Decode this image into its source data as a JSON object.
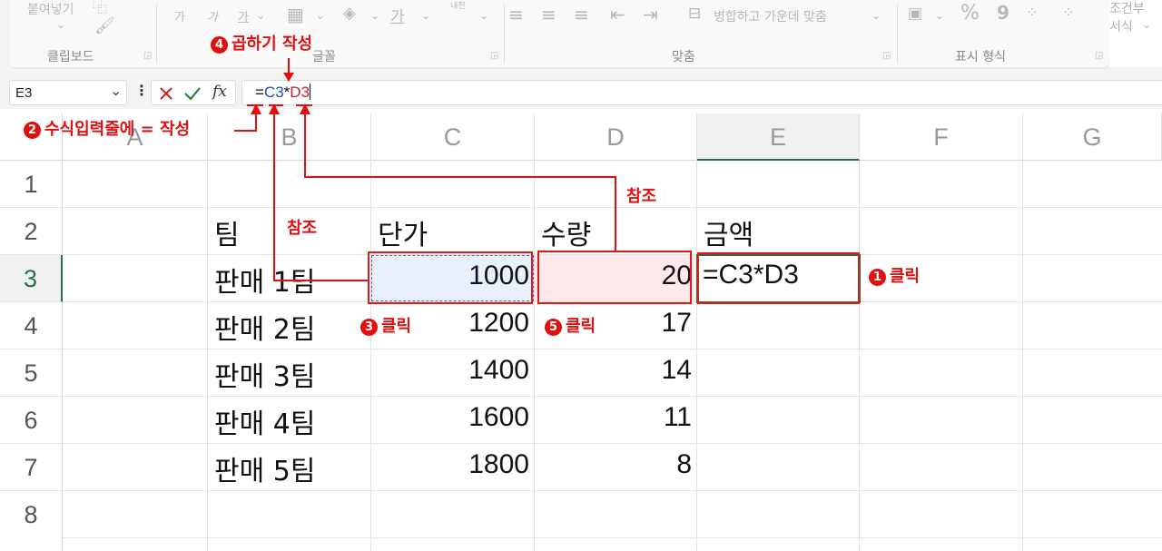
{
  "ribbon": {
    "clipboard": {
      "paste_label": "붙여넣기",
      "group_label": "클립보드"
    },
    "font": {
      "group_label": "글꼴",
      "btn1": "가",
      "btn2": "가",
      "btn3": "가",
      "btn4": "가",
      "phonetic": "내천"
    },
    "alignment": {
      "merge_label": "병합하고 가운데 맞춤",
      "group_label": "맞춤"
    },
    "number": {
      "percent": "%",
      "comma": "9",
      "group_label": "표시 형식"
    },
    "styles": {
      "conditional_label": "조건부 서식"
    }
  },
  "formula_bar": {
    "name_box": "E3",
    "formula_eq": "=",
    "formula_ref1": "C3",
    "formula_op": "*",
    "formula_ref2": "D3",
    "fx": "fx"
  },
  "sheet": {
    "columns": [
      "A",
      "B",
      "C",
      "D",
      "E",
      "F",
      "G"
    ],
    "rows": [
      "1",
      "2",
      "3",
      "4",
      "5",
      "6",
      "7",
      "8"
    ],
    "headers": {
      "team": "팀",
      "unit_price": "단가",
      "quantity": "수량",
      "amount": "금액"
    },
    "data": [
      {
        "team": "판매 1팀",
        "price": "1000",
        "qty": "20",
        "amount": "=C3*D3"
      },
      {
        "team": "판매 2팀",
        "price": "1200",
        "qty": "17"
      },
      {
        "team": "판매 3팀",
        "price": "1400",
        "qty": "14"
      },
      {
        "team": "판매 4팀",
        "price": "1600",
        "qty": "11"
      },
      {
        "team": "판매 5팀",
        "price": "1800",
        "qty": "8"
      }
    ]
  },
  "annotations": {
    "step1": {
      "num": "1",
      "text": "클릭"
    },
    "step2": {
      "num": "2",
      "text": "수식입력줄에  = 작성"
    },
    "step3": {
      "num": "3",
      "text": "클릭"
    },
    "step4": {
      "num": "4",
      "text": "곱하기 작성"
    },
    "step5": {
      "num": "5",
      "text": "클릭"
    },
    "ref_left": "참조",
    "ref_right": "참조"
  },
  "colors": {
    "accent_red": "#e01010",
    "selected_green": "#217346",
    "c3_fill": "#e8f0fb",
    "d3_fill": "#fde9e9",
    "ref_blue": "#1f4fbf",
    "ref_red": "#c0262c"
  }
}
